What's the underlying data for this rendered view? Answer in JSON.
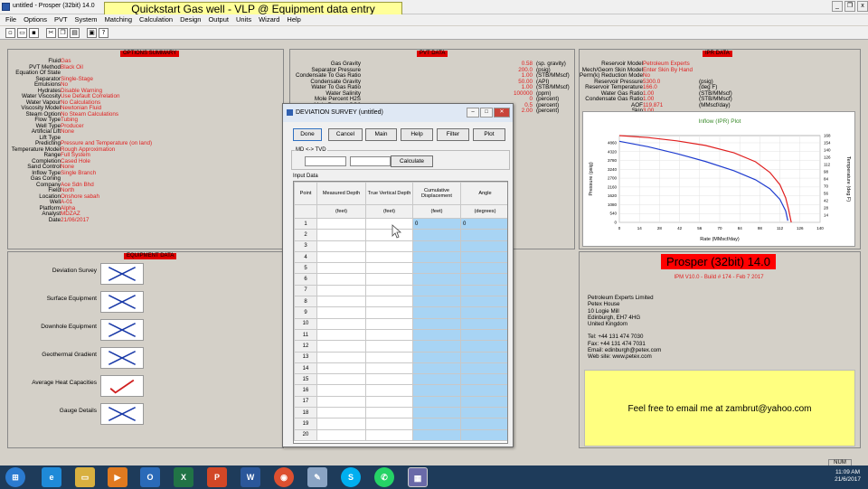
{
  "window": {
    "title": "untitled - Prosper (32bit) 14.0",
    "banner": "Quickstart Gas well - VLP @ Equipment data entry"
  },
  "menu": [
    "File",
    "Options",
    "PVT",
    "System",
    "Matching",
    "Calculation",
    "Design",
    "Output",
    "Units",
    "Wizard",
    "Help"
  ],
  "options_summary": {
    "title": "OPTIONS SUMMARY",
    "rows": [
      {
        "k": "Fluid",
        "v": "Gas"
      },
      {
        "k": "PVT Method",
        "v": "Black Oil"
      },
      {
        "k": "Equation Of State",
        "v": ""
      },
      {
        "k": "Separator",
        "v": "Single-Stage"
      },
      {
        "k": "Emulsions",
        "v": "No"
      },
      {
        "k": "Hydrates",
        "v": "Disable Warning"
      },
      {
        "k": "Water Viscosity",
        "v": "Use Default Correlation"
      },
      {
        "k": "Water Vapour",
        "v": "No Calculations"
      },
      {
        "k": "Viscosity Model",
        "v": "Newtonian Fluid"
      },
      {
        "k": "Steam Option",
        "v": "No Steam Calculations"
      },
      {
        "k": "Flow Type",
        "v": "Tubing"
      },
      {
        "k": "Well Type",
        "v": "Producer"
      },
      {
        "k": "Artificial Lift",
        "v": "None"
      },
      {
        "k": "Lift Type",
        "v": ""
      },
      {
        "k": "Predicting",
        "v": "Pressure and Temperature (on land)"
      },
      {
        "k": "Temperature Model",
        "v": "Rough Approximation"
      },
      {
        "k": "Range",
        "v": "Full System"
      },
      {
        "k": "Completion",
        "v": "Cased Hole"
      },
      {
        "k": "Sand Control",
        "v": "None"
      },
      {
        "k": "Inflow Type",
        "v": "Single Branch"
      },
      {
        "k": "Gas Coning",
        "v": ""
      },
      {
        "k": "Company",
        "v": "Ace Sdn Bhd"
      },
      {
        "k": "Field",
        "v": "North"
      },
      {
        "k": "Location",
        "v": "Onshore sabah"
      },
      {
        "k": "Well",
        "v": "A-01"
      },
      {
        "k": "Platform",
        "v": "Alpha"
      },
      {
        "k": "Analyst",
        "v": "MDZAZ"
      },
      {
        "k": "Date",
        "v": "21/06/2017"
      }
    ]
  },
  "pvt_data": {
    "title": "PVT DATA",
    "rows": [
      {
        "k": "Gas Gravity",
        "v": "0.58",
        "u": "(sp. gravity)"
      },
      {
        "k": "Separator Pressure",
        "v": "200.0",
        "u": "(psig)"
      },
      {
        "k": "Condensate To Gas Ratio",
        "v": "1.00",
        "u": "(STB/MMscf)"
      },
      {
        "k": "Condensate Gravity",
        "v": "50.00",
        "u": "(API)"
      },
      {
        "k": "Water To Gas Ratio",
        "v": "1.00",
        "u": "(STB/MMscf)"
      },
      {
        "k": "Water Salinity",
        "v": "100000",
        "u": "(ppm)"
      },
      {
        "k": "Mole Percent H2S",
        "v": "0",
        "u": "(percent)"
      },
      {
        "k": "Mole Percent CO2",
        "v": "0.5",
        "u": "(percent)"
      },
      {
        "k": "",
        "v": "2.00",
        "u": "(percent)"
      }
    ]
  },
  "ipr_data": {
    "title": "IPR DATA",
    "rows": [
      {
        "k": "Reservoir Model",
        "v": "Petroleum Experts",
        "u": ""
      },
      {
        "k": "Mech/Geom Skin Model",
        "v": "Enter Skin By Hand",
        "u": ""
      },
      {
        "k": "Perm(k) Reduction Model",
        "v": "No",
        "u": ""
      },
      {
        "k": "Reservoir Pressure",
        "v": "5300.0",
        "u": "(psig)"
      },
      {
        "k": "Reservoir Temperature",
        "v": "166.0",
        "u": "(deg F)"
      },
      {
        "k": "Water Gas Ratio",
        "v": "1.00",
        "u": "(STB/MMscf)"
      },
      {
        "k": "Condensate Gas Ratio",
        "v": "1.00",
        "u": "(STB/MMscf)"
      },
      {
        "k": "AOF",
        "v": "119.871",
        "u": "(MMscf/day)"
      },
      {
        "k": "Skin",
        "v": "3.00",
        "u": ""
      }
    ]
  },
  "chart_data": {
    "type": "line",
    "title": "Inflow (IPR) Plot",
    "xlabel": "Rate (MMscf/day)",
    "ylabel": "Pressure (psig)",
    "y2label": "Temperature (deg F)",
    "xlim": [
      0,
      140
    ],
    "ylim": [
      0,
      5300
    ],
    "y2lim": [
      0,
      168
    ],
    "xticks": [
      0,
      14,
      28,
      42,
      56,
      70,
      84,
      98,
      112,
      126,
      140
    ],
    "yticks": [
      0,
      540,
      1080,
      1620,
      2160,
      2700,
      3240,
      3780,
      4320,
      4860,
      5400
    ],
    "y2ticks": [
      14,
      28,
      42,
      56,
      70,
      84,
      98,
      112,
      126,
      140,
      154,
      168
    ],
    "series": [
      {
        "color": "#e02020",
        "x": [
          0,
          20,
          40,
          60,
          80,
          95,
          105,
          112,
          116,
          118,
          119.9
        ],
        "y": [
          5300,
          5180,
          4980,
          4700,
          4250,
          3700,
          3050,
          2300,
          1500,
          800,
          0
        ]
      },
      {
        "color": "#1f3ccf",
        "x": [
          0,
          20,
          40,
          60,
          80,
          95,
          105,
          112,
          116,
          117.5
        ],
        "y": [
          4950,
          4620,
          4200,
          3720,
          3150,
          2600,
          2050,
          1400,
          700,
          100
        ]
      }
    ]
  },
  "equipment": {
    "title": "EQUIPMENT DATA",
    "items": [
      {
        "label": "Deviation Survey",
        "state": "cross"
      },
      {
        "label": "Surface Equipment",
        "state": "cross"
      },
      {
        "label": "Downhole Equipment",
        "state": "cross"
      },
      {
        "label": "Geothermal Gradient",
        "state": "cross"
      },
      {
        "label": "Average Heat Capacities",
        "state": "tick"
      },
      {
        "label": "Gauge Details",
        "state": "cross"
      }
    ]
  },
  "about": {
    "title": "Prosper (32bit) 14.0",
    "build": "IPM V10.0 - Build # 174 - Feb  7 2017",
    "address": [
      "Petroleum Experts Limited",
      "Petex House",
      "10 Logie Mill",
      "Edinburgh, EH7 4HG",
      "United Kingdom",
      "",
      "Tel: +44 131 474 7030",
      "Fax: +44 131 474 7031",
      "Email: edinburgh@petex.com",
      "Web site: www.petex.com"
    ],
    "note": "Feel free to email me at zambrut@yahoo.com"
  },
  "dialog": {
    "title": "DEVIATION SURVEY (untitled)",
    "buttons": [
      "Done",
      "Cancel",
      "Main",
      "Help",
      "Filter",
      "Plot"
    ],
    "md_tvd_label": "MD <-> TVD",
    "calculate": "Calculate",
    "input_label": "Input Data",
    "columns": [
      {
        "h": "Point",
        "u": ""
      },
      {
        "h": "Measured Depth",
        "u": "(feet)"
      },
      {
        "h": "True Vertical Depth",
        "u": "(feet)"
      },
      {
        "h": "Cumulative Displacement",
        "u": "(feet)"
      },
      {
        "h": "Angle",
        "u": "(degrees)"
      }
    ],
    "rows": [
      [
        "1",
        "",
        "",
        "0",
        "0"
      ],
      [
        "2",
        "",
        "",
        "",
        ""
      ],
      [
        "3",
        "",
        "",
        "",
        ""
      ],
      [
        "4",
        "",
        "",
        "",
        ""
      ],
      [
        "5",
        "",
        "",
        "",
        ""
      ],
      [
        "6",
        "",
        "",
        "",
        ""
      ],
      [
        "7",
        "",
        "",
        "",
        ""
      ],
      [
        "8",
        "",
        "",
        "",
        ""
      ],
      [
        "9",
        "",
        "",
        "",
        ""
      ],
      [
        "10",
        "",
        "",
        "",
        ""
      ],
      [
        "11",
        "",
        "",
        "",
        ""
      ],
      [
        "12",
        "",
        "",
        "",
        ""
      ],
      [
        "13",
        "",
        "",
        "",
        ""
      ],
      [
        "14",
        "",
        "",
        "",
        ""
      ],
      [
        "15",
        "",
        "",
        "",
        ""
      ],
      [
        "16",
        "",
        "",
        "",
        ""
      ],
      [
        "17",
        "",
        "",
        "",
        ""
      ],
      [
        "18",
        "",
        "",
        "",
        ""
      ],
      [
        "19",
        "",
        "",
        "",
        ""
      ],
      [
        "20",
        "",
        "",
        "",
        ""
      ]
    ]
  },
  "status": {
    "num": "NUM",
    "time": "11:09 AM",
    "date": "21/6/2017"
  }
}
